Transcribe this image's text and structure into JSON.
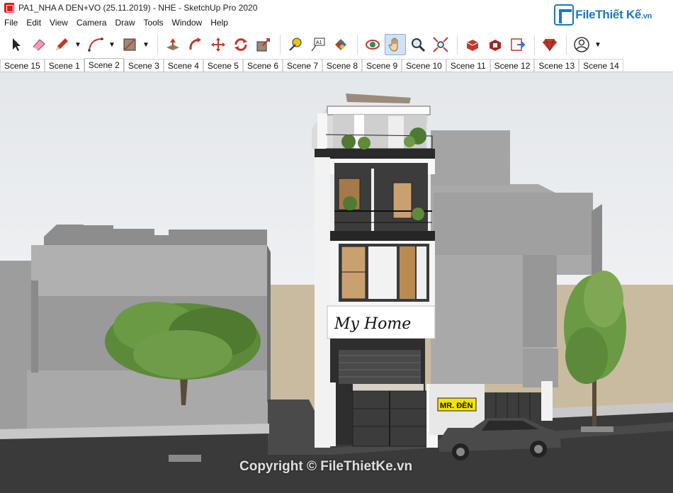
{
  "window": {
    "title": "PA1_NHA A DEN+VO (25.11.2019) - NHE - SketchUp Pro 2020"
  },
  "brand": {
    "logo_main": "File",
    "logo_accent": "Thiết Kế",
    "logo_tld": ".vn"
  },
  "menu": [
    "File",
    "Edit",
    "View",
    "Camera",
    "Draw",
    "Tools",
    "Window",
    "Help"
  ],
  "toolbar": {
    "tools": [
      {
        "name": "select-tool",
        "icon": "arrow-cursor-icon",
        "active": false
      },
      {
        "name": "eraser-tool",
        "icon": "eraser-icon",
        "active": false
      },
      {
        "name": "pencil-tool",
        "icon": "pencil-icon",
        "active": false,
        "dropdown": true
      },
      {
        "name": "arc-tool",
        "icon": "arc-icon",
        "active": false,
        "dropdown": true
      },
      {
        "name": "rectangle-tool",
        "icon": "rectangle-icon",
        "active": false,
        "dropdown": true
      },
      {
        "name": "push-pull-tool",
        "icon": "push-pull-icon",
        "active": false
      },
      {
        "name": "follow-me-tool",
        "icon": "follow-me-icon",
        "active": false
      },
      {
        "name": "move-tool",
        "icon": "move-icon",
        "active": false
      },
      {
        "name": "rotate-tool",
        "icon": "rotate-icon",
        "active": false
      },
      {
        "name": "scale-tool",
        "icon": "scale-icon",
        "active": false
      },
      {
        "name": "tape-measure-tool",
        "icon": "tape-measure-icon",
        "active": false
      },
      {
        "name": "text-tool",
        "icon": "text-label-icon",
        "active": false
      },
      {
        "name": "paint-bucket-tool",
        "icon": "paint-bucket-icon",
        "active": false
      },
      {
        "name": "orbit-tool",
        "icon": "orbit-icon",
        "active": false
      },
      {
        "name": "pan-tool",
        "icon": "hand-icon",
        "active": true
      },
      {
        "name": "zoom-tool",
        "icon": "magnifier-icon",
        "active": false
      },
      {
        "name": "zoom-extents-tool",
        "icon": "zoom-extents-icon",
        "active": false
      },
      {
        "name": "warehouse-tool",
        "icon": "3d-warehouse-icon",
        "active": false
      },
      {
        "name": "extension-warehouse-tool",
        "icon": "extension-warehouse-icon",
        "active": false
      },
      {
        "name": "send-to-layout-tool",
        "icon": "send-to-layout-icon",
        "active": false
      },
      {
        "name": "extension-manager-tool",
        "icon": "ruby-gem-icon",
        "active": false
      },
      {
        "name": "account-tool",
        "icon": "user-account-icon",
        "active": false,
        "dropdown": true
      }
    ],
    "text_tool_label": "A1"
  },
  "scenes": {
    "tabs": [
      "Scene 15",
      "Scene 1",
      "Scene 2",
      "Scene 3",
      "Scene 4",
      "Scene 5",
      "Scene 6",
      "Scene 7",
      "Scene 8",
      "Scene 9",
      "Scene 10",
      "Scene 11",
      "Scene 12",
      "Scene 13",
      "Scene 14"
    ],
    "active": "Scene 2"
  },
  "model": {
    "sign_text": "My Home",
    "plate_text": "MR. ĐÈN"
  },
  "watermark": "Copyright © FileThietKe.vn",
  "colors": {
    "sky": "#e9ecef",
    "ground": "#c9bba0",
    "road": "#3a3a3a",
    "neighbor": "#a9a9a9",
    "house_dark": "#2b2b2b",
    "sign_bg": "#ffffff",
    "plate_bg": "#f5e400",
    "tree": "#5d8a3a",
    "active_tool": "#cfe3f7"
  }
}
